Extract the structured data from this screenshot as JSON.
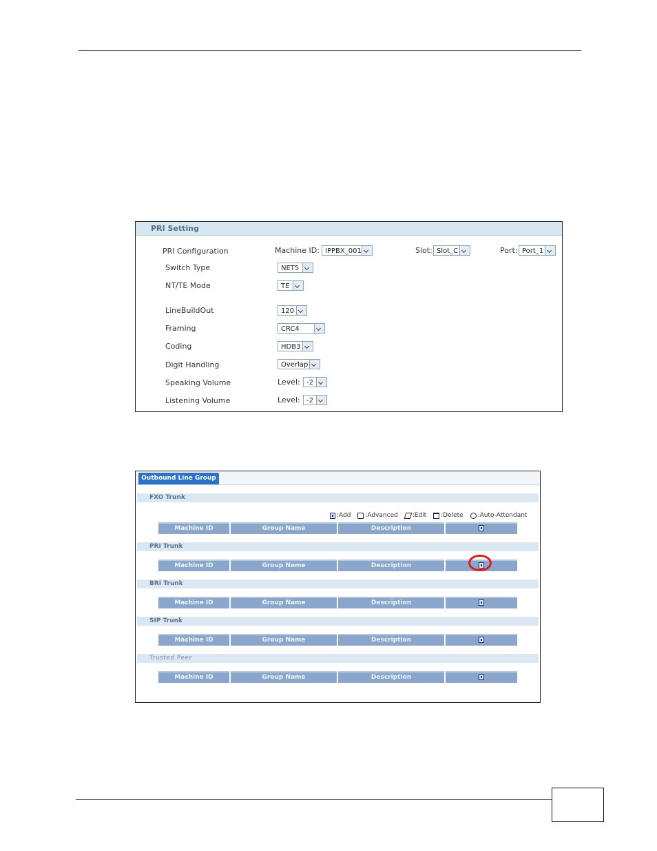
{
  "pri_setting": {
    "title": "PRI Setting",
    "rows": [
      {
        "label": "PRI Configuration"
      },
      {
        "label": "Switch Type",
        "value": "NET5"
      },
      {
        "label": "NT/TE Mode",
        "value": "TE"
      },
      {
        "label": "LineBuildOut",
        "value": "120"
      },
      {
        "label": "Framing",
        "value": "CRC4"
      },
      {
        "label": "Coding",
        "value": "HDB3"
      },
      {
        "label": "Digit Handling",
        "value": "Overlap"
      },
      {
        "label": "Speaking Volume",
        "prefix": "Level:",
        "value": "-2"
      },
      {
        "label": "Listening Volume",
        "prefix": "Level:",
        "value": "-2"
      }
    ],
    "machine_id": {
      "label": "Machine ID:",
      "value": "IPPBX_001"
    },
    "slot": {
      "label": "Slot:",
      "value": "Slot_C"
    },
    "port": {
      "label": "Port:",
      "value": "Port_1"
    }
  },
  "outbound": {
    "tab": "Outbound Line Group",
    "legend": [
      {
        "icon": "add-icon",
        "label": ":Add"
      },
      {
        "icon": "advanced-icon",
        "label": ":Advanced"
      },
      {
        "icon": "edit-icon",
        "label": ":Edit"
      },
      {
        "icon": "delete-icon",
        "label": ":Delete"
      },
      {
        "icon": "auto-attendant-icon",
        "label": ":Auto-Attendant"
      }
    ],
    "columns": [
      "Machine ID",
      "Group Name",
      "Description"
    ],
    "sections": [
      {
        "name": "FXO Trunk"
      },
      {
        "name": "PRI Trunk"
      },
      {
        "name": "BRI Trunk"
      },
      {
        "name": "SIP Trunk"
      },
      {
        "name": "Trusted Peer"
      }
    ]
  },
  "colors": {
    "header_bg": "#d8e8f2",
    "tab_blue": "#2d73c4",
    "table_header": "#8aa7cb",
    "highlight": "#e11c1c"
  }
}
